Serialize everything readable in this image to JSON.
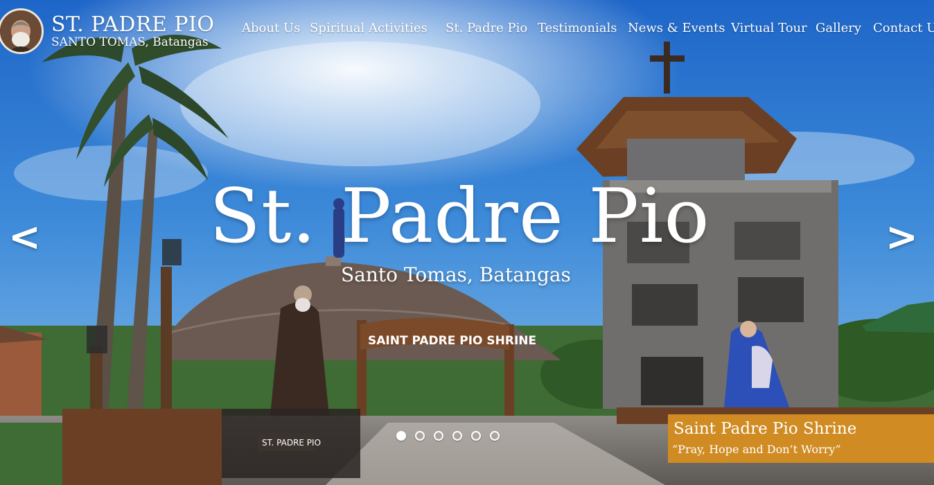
{
  "brand": {
    "title": "ST. PADRE PIO",
    "subtitle": "SANTO TOMAS, Batangas",
    "avatar_icon": "saint-portrait-icon"
  },
  "nav": {
    "items": [
      {
        "label": "About Us"
      },
      {
        "label": "Spiritual Activities"
      },
      {
        "label": "St. Padre Pio"
      },
      {
        "label": "Testimonials"
      },
      {
        "label": "News & Events"
      },
      {
        "label": "Virtual Tour"
      },
      {
        "label": "Gallery"
      },
      {
        "label": "Contact Us"
      }
    ]
  },
  "hero": {
    "title": "St. Padre Pio",
    "subtitle": "Santo Tomas, Batangas",
    "prev_label": "<",
    "next_label": ">",
    "sign_text": "SAINT PADRE PIO SHRINE",
    "plaque_text": "ST. PADRE PIO"
  },
  "slider": {
    "slide_count": 6,
    "active_index": 0
  },
  "caption": {
    "title": "Saint Padre Pio Shrine",
    "quote": "“Pray, Hope and Don’t Worry”"
  },
  "colors": {
    "sky_top": "#1f6fd1",
    "sky_bottom": "#7cb9e8",
    "caption_bg": "#d08b22",
    "text": "#ffffff"
  }
}
